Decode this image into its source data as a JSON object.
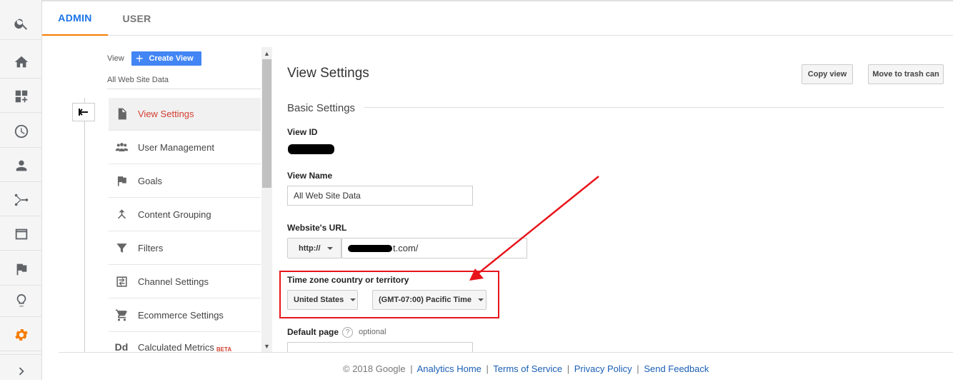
{
  "tabs": {
    "admin": "ADMIN",
    "user": "USER"
  },
  "nav": {
    "view_label": "View",
    "create_view": "Create View",
    "view_name": "All Web Site Data",
    "items": [
      {
        "label": "View Settings",
        "icon": "document-icon"
      },
      {
        "label": "User Management",
        "icon": "people-icon"
      },
      {
        "label": "Goals",
        "icon": "flag-icon"
      },
      {
        "label": "Content Grouping",
        "icon": "merge-icon"
      },
      {
        "label": "Filters",
        "icon": "filter-icon"
      },
      {
        "label": "Channel Settings",
        "icon": "channel-icon"
      },
      {
        "label": "Ecommerce Settings",
        "icon": "cart-icon"
      },
      {
        "label": "Calculated Metrics",
        "icon": "dd-icon",
        "badge": "BETA"
      }
    ],
    "calc_icon_text": "Dd"
  },
  "main": {
    "title": "View Settings",
    "copy_view": "Copy view",
    "move_to_trash": "Move to trash can",
    "basic_settings": "Basic Settings",
    "view_id_label": "View ID",
    "view_name_label": "View Name",
    "view_name_value": "All Web Site Data",
    "website_url_label": "Website's URL",
    "protocol": "http://",
    "url_suffix": "t.com/",
    "timezone_label": "Time zone country or territory",
    "country": "United States",
    "timezone": "(GMT-07:00) Pacific Time",
    "default_page_label": "Default page",
    "help": "?",
    "optional": "optional"
  },
  "footer": {
    "copyright": "© 2018 Google",
    "links": [
      "Analytics Home",
      "Terms of Service",
      "Privacy Policy",
      "Send Feedback"
    ],
    "sep": "|"
  },
  "colors": {
    "accent_orange": "#f57c00",
    "link_blue": "#1a73e8",
    "active_red": "#d23f31",
    "annotation_red": "#e8141b",
    "create_blue": "#4285f4"
  }
}
